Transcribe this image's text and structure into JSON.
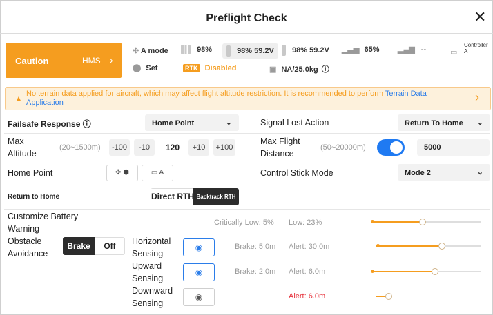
{
  "header": {
    "title": "Preflight Check",
    "close_icon": "close-icon"
  },
  "status": {
    "caution_label": "Caution",
    "hms_label": "HMS",
    "flight_mode": "A mode",
    "battery1": "98%",
    "battery2": "98% 59.2V",
    "battery3": "98% 59.2V",
    "signal": "65%",
    "rc_value": "--",
    "controller_label": "Controller A",
    "home_label": "Set",
    "rtk_badge": "RTK",
    "rtk_status": "Disabled",
    "payload": "NA/25.0kg"
  },
  "banner": {
    "text": "No terrain data applied for aircraft, which may affect flight altitude restriction. It is recommended to perform",
    "link": "Terrain Data Application"
  },
  "settings": {
    "failsafe_label": "Failsafe Response",
    "failsafe_value": "Home Point",
    "signal_lost_label": "Signal Lost Action",
    "signal_lost_value": "Return To Home",
    "max_alt_label": "Max Altitude",
    "max_alt_range": "(20~1500m)",
    "minus100": "-100",
    "minus10": "-10",
    "max_alt_value": "120",
    "plus10": "+10",
    "plus100": "+100",
    "max_dist_label": "Max Flight Distance",
    "max_dist_range": "(50~20000m)",
    "max_dist_enabled": true,
    "max_dist_value": "5000",
    "home_point_label": "Home Point",
    "home_btn2_label": "A",
    "control_stick_label": "Control Stick Mode",
    "control_stick_value": "Mode 2",
    "rth_label": "Return to Home",
    "rth_direct": "Direct RTH",
    "rth_backtrack": "Backtrack RTH",
    "rth_selected": "Backtrack RTH",
    "battery_warn_label": "Customize Battery Warning",
    "critically_low": "Critically Low: 5%",
    "low": "Low: 23%",
    "obstacle_label": "Obstacle Avoidance",
    "brake_label": "Brake",
    "off_label": "Off",
    "obstacle_selected": "Brake",
    "sensing": [
      {
        "label": "Horizontal Sensing",
        "brake": "Brake: 5.0m",
        "alert": "Alert: 30.0m",
        "enabled": true
      },
      {
        "label": "Upward Sensing",
        "brake": "Brake: 2.0m",
        "alert": "Alert: 6.0m",
        "enabled": true
      },
      {
        "label": "Downward Sensing",
        "brake": "",
        "alert": "Alert: 6.0m",
        "enabled": false
      }
    ]
  },
  "colors": {
    "accent": "#f59d1f",
    "blue": "#1f7af2",
    "alert_red": "#e6323c"
  }
}
